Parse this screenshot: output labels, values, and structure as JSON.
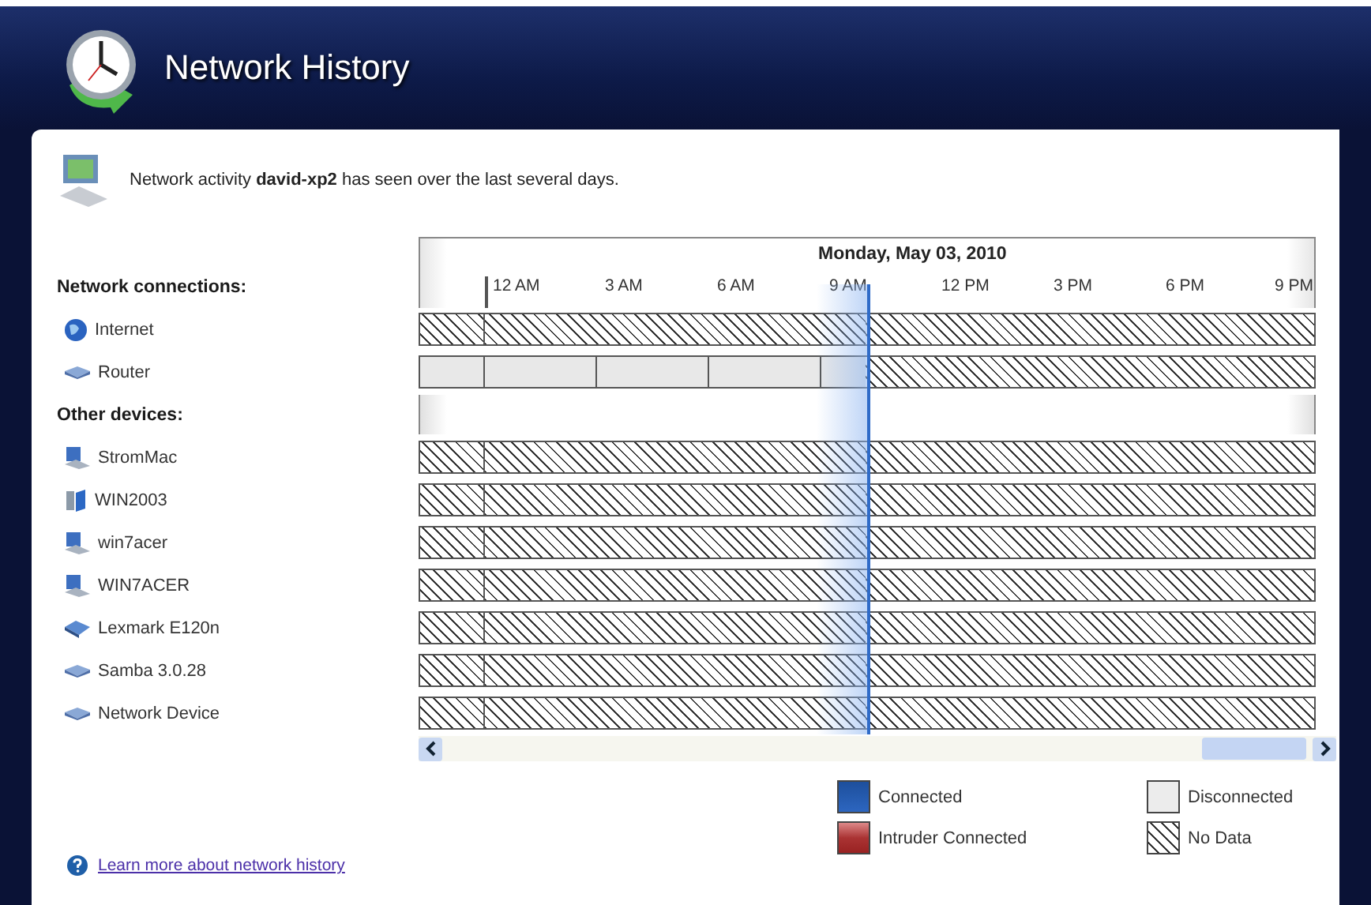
{
  "window": {
    "title": "Network History"
  },
  "description": "Network activity **david-xp2** has seen over the last several days.",
  "timeline": {
    "date": "Monday, May 03, 2010",
    "hours": [
      "12 AM",
      "3 AM",
      "6 AM",
      "9 AM",
      "12 PM",
      "3 PM",
      "6 PM",
      "9 PM"
    ]
  },
  "groups": [
    {
      "heading": "Network connections:",
      "items": [
        {
          "name": "Internet",
          "kind": "globe",
          "segments": [
            {
              "kind": "no_data"
            },
            {
              "kind": "no_data"
            }
          ]
        },
        {
          "name": "Router",
          "kind": "router",
          "segments": [
            {
              "kind": "disconnected"
            },
            {
              "kind": "no_data"
            }
          ]
        }
      ]
    },
    {
      "heading": "Other devices:",
      "items": [
        {
          "name": "StromMac",
          "kind": "computer",
          "segments": [
            {
              "kind": "no_data"
            },
            {
              "kind": "no_data"
            }
          ]
        },
        {
          "name": "WIN2003",
          "kind": "server",
          "segments": [
            {
              "kind": "no_data"
            },
            {
              "kind": "no_data"
            }
          ]
        },
        {
          "name": "win7acer",
          "kind": "computer",
          "segments": [
            {
              "kind": "no_data"
            },
            {
              "kind": "no_data"
            }
          ]
        },
        {
          "name": "WIN7ACER",
          "kind": "computer",
          "segments": [
            {
              "kind": "no_data"
            },
            {
              "kind": "no_data"
            }
          ]
        },
        {
          "name": "Lexmark E120n",
          "kind": "printer",
          "segments": [
            {
              "kind": "no_data"
            },
            {
              "kind": "no_data"
            }
          ]
        },
        {
          "name": "Samba 3.0.28",
          "kind": "router",
          "segments": [
            {
              "kind": "no_data"
            },
            {
              "kind": "no_data"
            }
          ]
        },
        {
          "name": "Network Device",
          "kind": "router",
          "segments": [
            {
              "kind": "no_data"
            },
            {
              "kind": "no_data"
            }
          ]
        }
      ]
    }
  ],
  "legend": [
    {
      "label": "Connected",
      "kind": "connected"
    },
    {
      "label": "Disconnected",
      "kind": "disconnected"
    },
    {
      "label": "Intruder Connected",
      "kind": "intruder"
    },
    {
      "label": "No Data",
      "kind": "no_data"
    }
  ],
  "help_link": "Learn more about network history"
}
